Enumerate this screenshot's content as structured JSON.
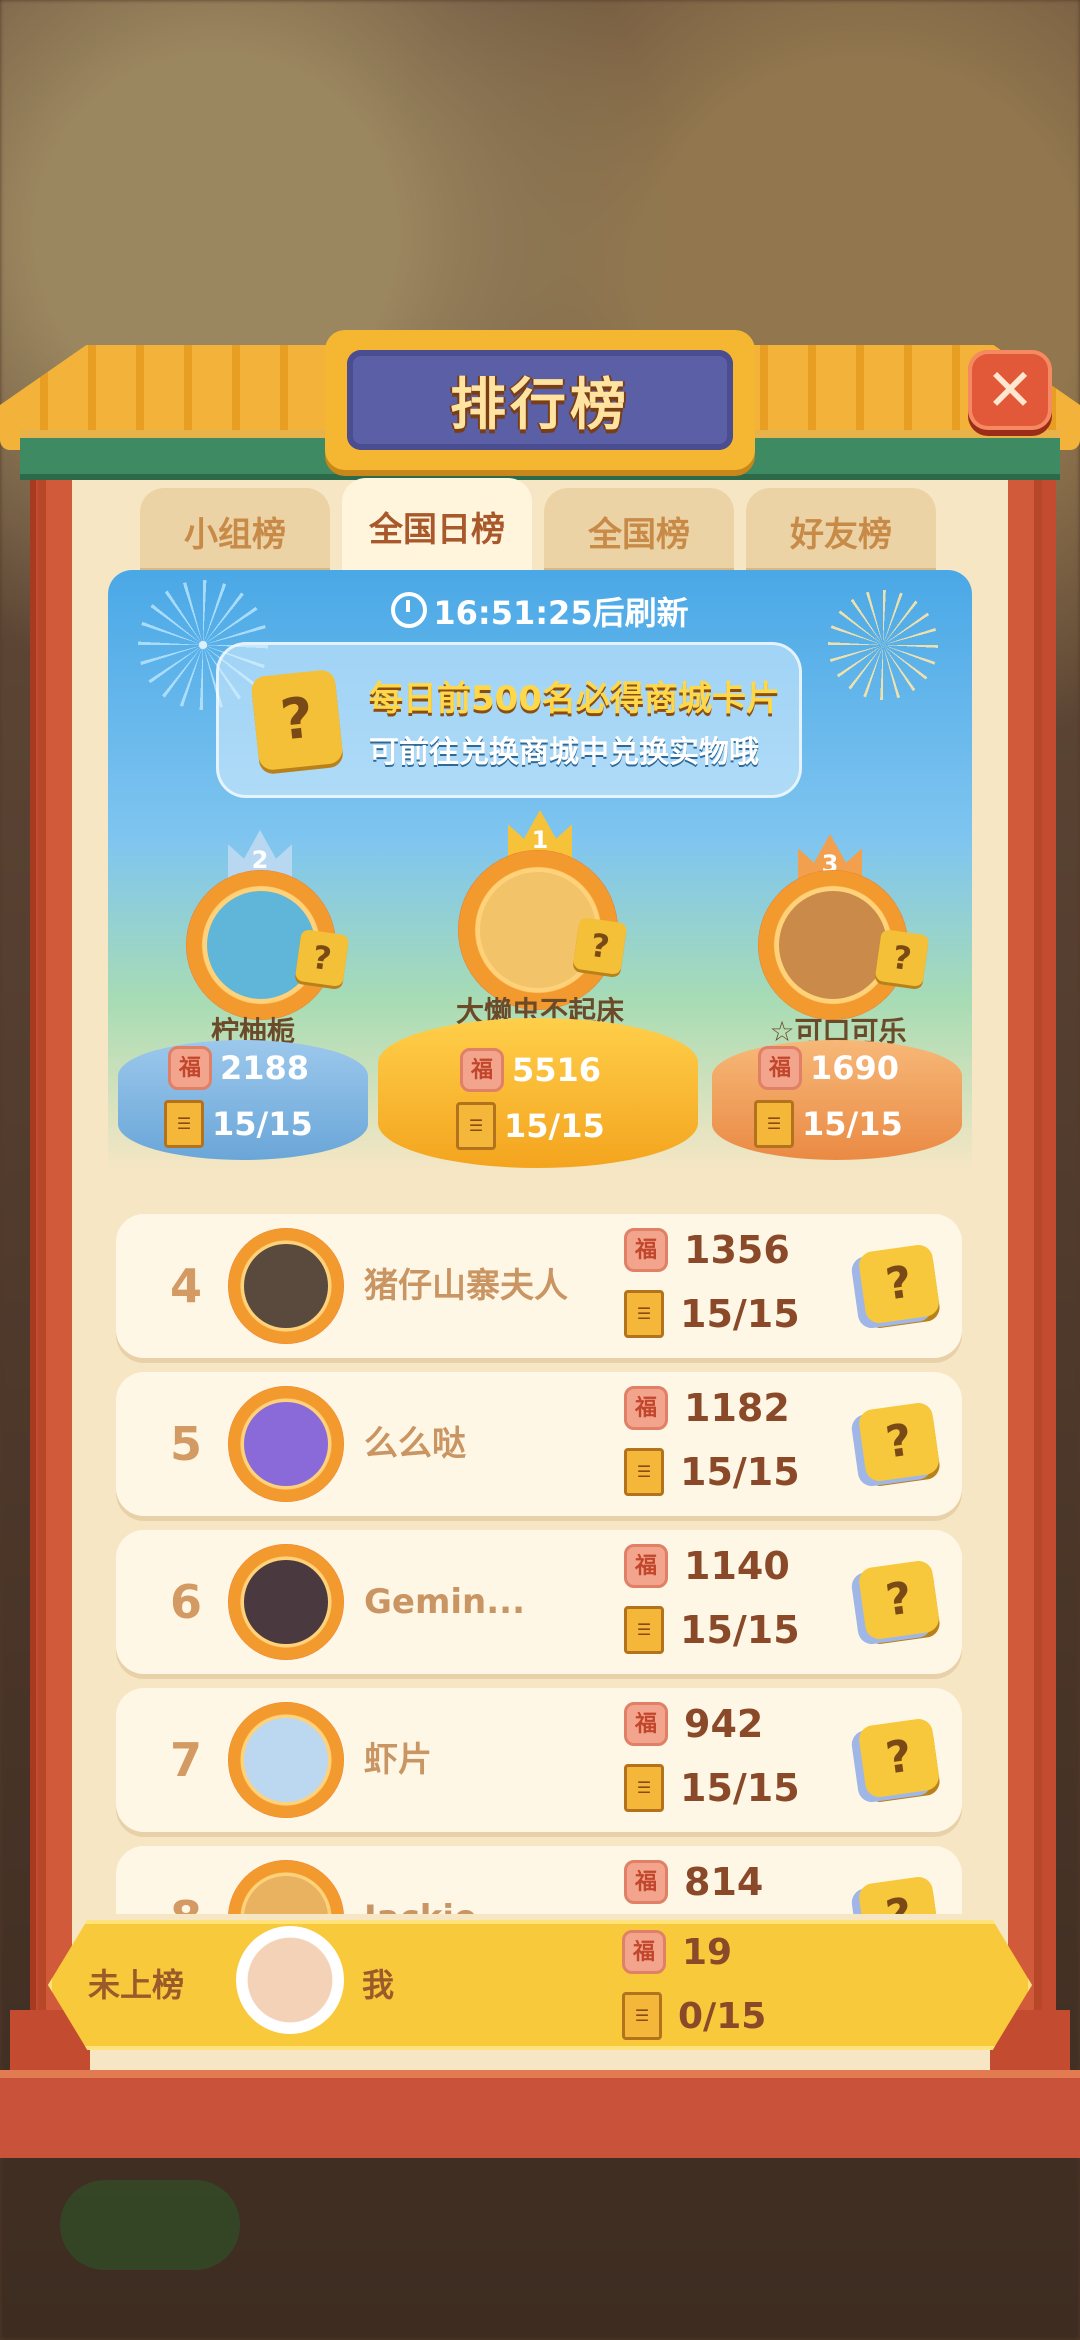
{
  "title": "排行榜",
  "close_icon": "✕",
  "tabs": [
    "小组榜",
    "全国日榜",
    "全国榜",
    "好友榜"
  ],
  "active_tab": 1,
  "timer": "16:51:25后刷新",
  "notice": {
    "line1": "每日前500名必得商城卡片",
    "line2": "可前往兑换商城中兑换实物哦"
  },
  "podium": {
    "first": {
      "rank": "1",
      "name": "大懒虫不起床",
      "score": "5516",
      "progress": "15/15"
    },
    "second": {
      "rank": "2",
      "name": "柠柚栀",
      "score": "2188",
      "progress": "15/15"
    },
    "third": {
      "rank": "3",
      "name": "☆可口可乐",
      "score": "1690",
      "progress": "15/15"
    }
  },
  "rows": [
    {
      "rank": "4",
      "name": "猪仔山寨夫人",
      "score": "1356",
      "progress": "15/15"
    },
    {
      "rank": "5",
      "name": "么么哒",
      "score": "1182",
      "progress": "15/15"
    },
    {
      "rank": "6",
      "name": "Gemin...",
      "score": "1140",
      "progress": "15/15"
    },
    {
      "rank": "7",
      "name": "虾片",
      "score": "942",
      "progress": "15/15"
    },
    {
      "rank": "8",
      "name": "Jackie",
      "score": "814",
      "progress": ""
    }
  ],
  "me": {
    "rank": "未上榜",
    "name": "我",
    "score": "19",
    "progress": "0/15"
  },
  "glyphs": {
    "fu": "福",
    "book": "☰",
    "card": "?"
  },
  "colors": {
    "frame": "#d05a3a",
    "roof": "#f3b33a",
    "title_plate": "#5b5fa6",
    "gold_bar": "#f9c93c",
    "second": "#7ab4e0",
    "first": "#f6b52c",
    "third": "#f09a52"
  }
}
